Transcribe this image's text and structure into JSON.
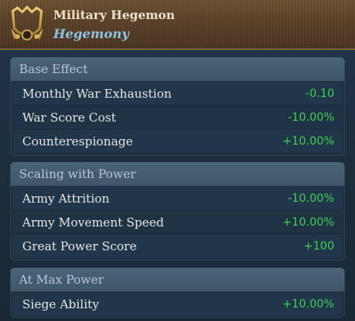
{
  "header": {
    "title": "Military Hegemon",
    "subtitle": "Hegemony",
    "icon": "military-hegemon-emblem-icon"
  },
  "colors": {
    "positive": "#3fcf55",
    "header_bg": "#5a4128",
    "subtitle": "#8fc6e6"
  },
  "sections": [
    {
      "title": "Base Effect",
      "rows": [
        {
          "label": "Monthly War Exhaustion",
          "value": "-0.10"
        },
        {
          "label": "War Score Cost",
          "value": "-10.00%"
        },
        {
          "label": "Counterespionage",
          "value": "+10.00%"
        }
      ]
    },
    {
      "title": "Scaling with Power",
      "rows": [
        {
          "label": "Army Attrition",
          "value": "-10.00%"
        },
        {
          "label": "Army Movement Speed",
          "value": "+10.00%"
        },
        {
          "label": "Great Power Score",
          "value": "+100"
        }
      ]
    },
    {
      "title": "At Max Power",
      "rows": [
        {
          "label": "Siege Ability",
          "value": "+10.00%"
        }
      ]
    }
  ]
}
